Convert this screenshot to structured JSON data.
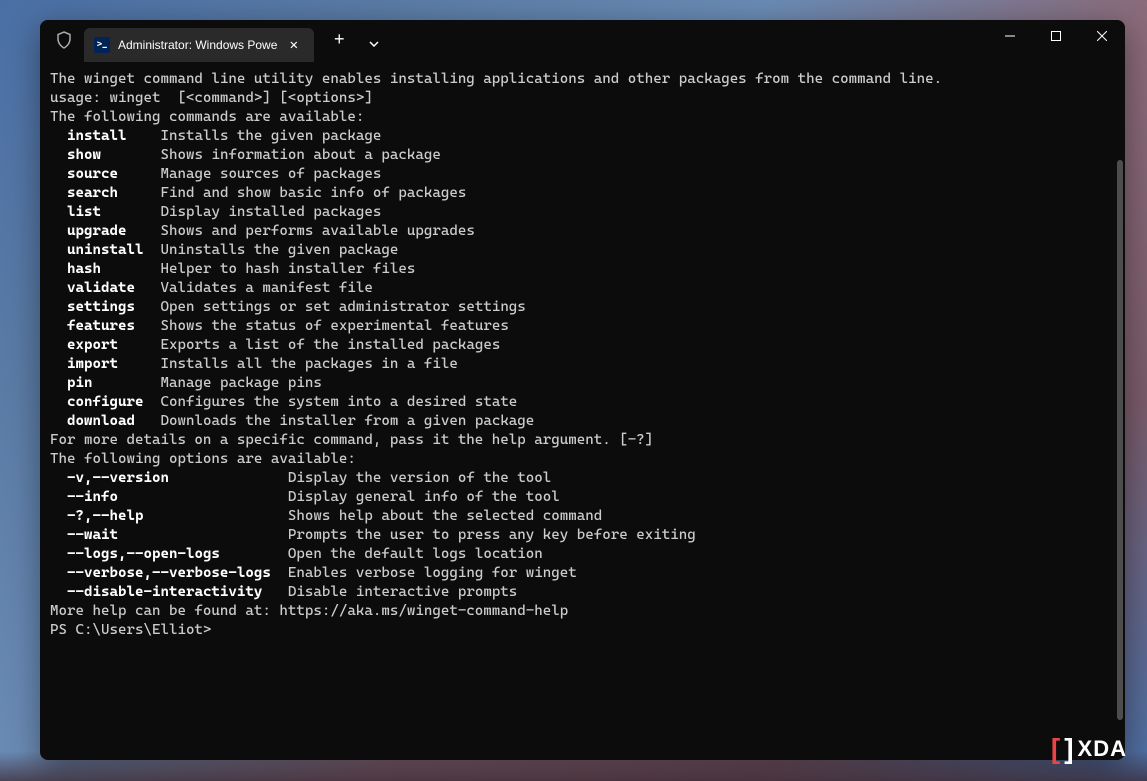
{
  "window": {
    "tab_title": "Administrator: Windows Powe",
    "tab_icon": ">_"
  },
  "terminal": {
    "intro": "The winget command line utility enables installing applications and other packages from the command line.",
    "usage": "usage: winget  [<command>] [<options>]",
    "commands_header": "The following commands are available:",
    "commands": [
      {
        "name": "install",
        "desc": "Installs the given package"
      },
      {
        "name": "show",
        "desc": "Shows information about a package"
      },
      {
        "name": "source",
        "desc": "Manage sources of packages"
      },
      {
        "name": "search",
        "desc": "Find and show basic info of packages"
      },
      {
        "name": "list",
        "desc": "Display installed packages"
      },
      {
        "name": "upgrade",
        "desc": "Shows and performs available upgrades"
      },
      {
        "name": "uninstall",
        "desc": "Uninstalls the given package"
      },
      {
        "name": "hash",
        "desc": "Helper to hash installer files"
      },
      {
        "name": "validate",
        "desc": "Validates a manifest file"
      },
      {
        "name": "settings",
        "desc": "Open settings or set administrator settings"
      },
      {
        "name": "features",
        "desc": "Shows the status of experimental features"
      },
      {
        "name": "export",
        "desc": "Exports a list of the installed packages"
      },
      {
        "name": "import",
        "desc": "Installs all the packages in a file"
      },
      {
        "name": "pin",
        "desc": "Manage package pins"
      },
      {
        "name": "configure",
        "desc": "Configures the system into a desired state"
      },
      {
        "name": "download",
        "desc": "Downloads the installer from a given package"
      }
    ],
    "details_hint": "For more details on a specific command, pass it the help argument. [-?]",
    "options_header": "The following options are available:",
    "options": [
      {
        "name": "-v,--version",
        "desc": "Display the version of the tool"
      },
      {
        "name": "--info",
        "desc": "Display general info of the tool"
      },
      {
        "name": "-?,--help",
        "desc": "Shows help about the selected command"
      },
      {
        "name": "--wait",
        "desc": "Prompts the user to press any key before exiting"
      },
      {
        "name": "--logs,--open-logs",
        "desc": "Open the default logs location"
      },
      {
        "name": "--verbose,--verbose-logs",
        "desc": "Enables verbose logging for winget"
      },
      {
        "name": "--disable-interactivity",
        "desc": "Disable interactive prompts"
      }
    ],
    "more_help": "More help can be found at: https://aka.ms/winget-command-help",
    "prompt": "PS C:\\Users\\Elliot>"
  },
  "logo": {
    "text": "XDA"
  }
}
